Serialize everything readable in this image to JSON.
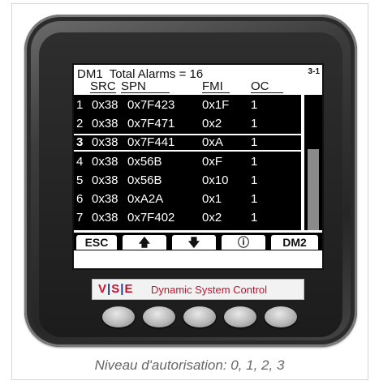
{
  "screen": {
    "header": {
      "line1": "DM1  Total Alarms = 16",
      "page_indicator": "3-1",
      "col_src": "SRC",
      "col_spn": "SPN",
      "col_fmi": "FMI",
      "col_oc": "OC"
    },
    "rows": [
      {
        "idx": "1",
        "src": "0x38",
        "spn": "0x7F423",
        "fmi": "0x1F",
        "oc": "1"
      },
      {
        "idx": "2",
        "src": "0x38",
        "spn": "0x7F471",
        "fmi": "0x2",
        "oc": "1"
      },
      {
        "idx": "3",
        "src": "0x38",
        "spn": "0x7F441",
        "fmi": "0xA",
        "oc": "1",
        "selected": true
      },
      {
        "idx": "4",
        "src": "0x38",
        "spn": "0x56B",
        "fmi": "0xF",
        "oc": "1"
      },
      {
        "idx": "5",
        "src": "0x38",
        "spn": "0x56B",
        "fmi": "0x10",
        "oc": "1"
      },
      {
        "idx": "6",
        "src": "0x38",
        "spn": "0xA2A",
        "fmi": "0x1",
        "oc": "1"
      },
      {
        "idx": "7",
        "src": "0x38",
        "spn": "0x7F402",
        "fmi": "0x2",
        "oc": "1"
      }
    ],
    "scrollbar": {
      "position_fraction": 0.4,
      "size_fraction": 0.6
    },
    "softkeys": {
      "esc": "ESC",
      "up": "🡅",
      "down": "🡇",
      "info": "ⓘ",
      "dm2": "DM2"
    }
  },
  "logo": {
    "mark_v": "V",
    "mark_s": "S",
    "mark_e": "E",
    "tagline": "Dynamic System Control"
  },
  "caption": "Niveau d'autorisation: 0, 1, 2, 3"
}
